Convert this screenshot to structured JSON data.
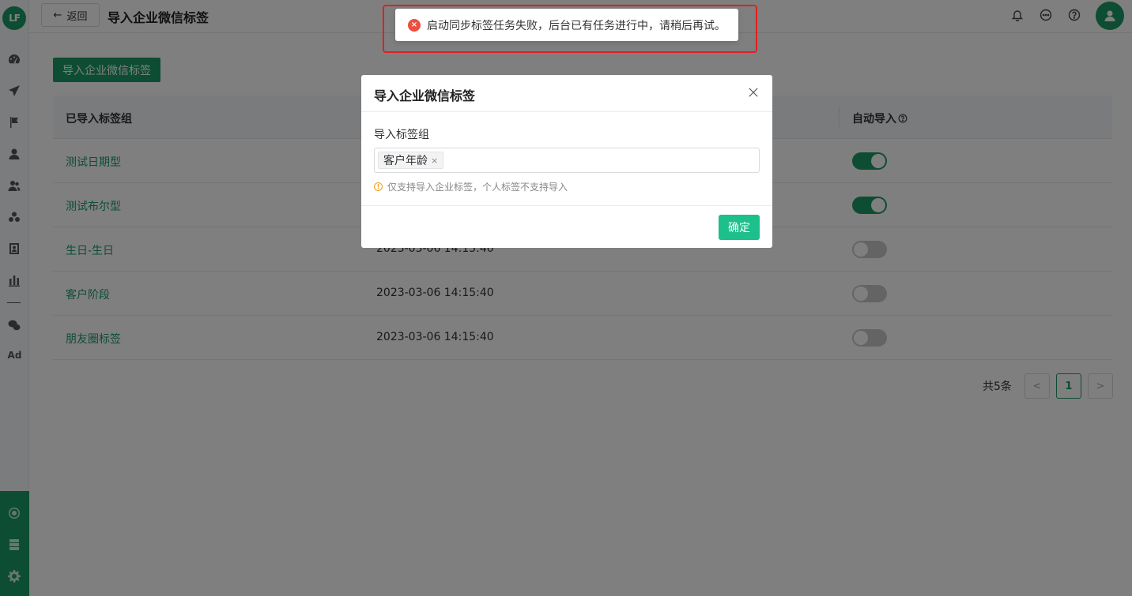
{
  "sidebar": {
    "logo": "LF",
    "ad_label": "Ad",
    "icons": [
      "dashboard-icon",
      "send-icon",
      "flag-icon",
      "user-icon",
      "users-icon",
      "group-icon",
      "contact-card-icon",
      "bar-chart-icon",
      "wechat-icon"
    ],
    "bottom_icons": [
      "hub-icon",
      "server-icon",
      "gear-icon"
    ]
  },
  "header": {
    "back_label": "返回",
    "title": "导入企业微信标签",
    "icons": [
      "bell-icon",
      "message-icon",
      "help-icon",
      "avatar-icon"
    ]
  },
  "main": {
    "import_button": "导入企业微信标签",
    "table": {
      "columns": [
        "已导入标签组",
        "",
        "自动导入"
      ],
      "rows": [
        {
          "name": "测试日期型",
          "time": "",
          "auto": true
        },
        {
          "name": "测试布尔型",
          "time": "",
          "auto": true
        },
        {
          "name": "生日-生日",
          "time": "2023-03-06 14:15:40",
          "auto": false
        },
        {
          "name": "客户阶段",
          "time": "2023-03-06 14:15:40",
          "auto": false
        },
        {
          "name": "朋友圈标签",
          "time": "2023-03-06 14:15:40",
          "auto": false
        }
      ]
    },
    "pagination": {
      "total": "共5条",
      "prev": "<",
      "current": "1",
      "next": ">"
    }
  },
  "modal": {
    "title": "导入企业微信标签",
    "close": "X",
    "field_label": "导入标签组",
    "tag": "客户年龄",
    "tag_remove": "×",
    "hint": "仅支持导入企业标签，个人标签不支持导入",
    "confirm": "确定"
  },
  "toast": {
    "message": "启动同步标签任务失败，后台已有任务进行中，请稍后再试。",
    "icon_text": "×"
  },
  "colors": {
    "brand": "#1b9b69",
    "confirm": "#1dbf8a",
    "error": "#ee4d3f",
    "highlight": "#e02020"
  }
}
